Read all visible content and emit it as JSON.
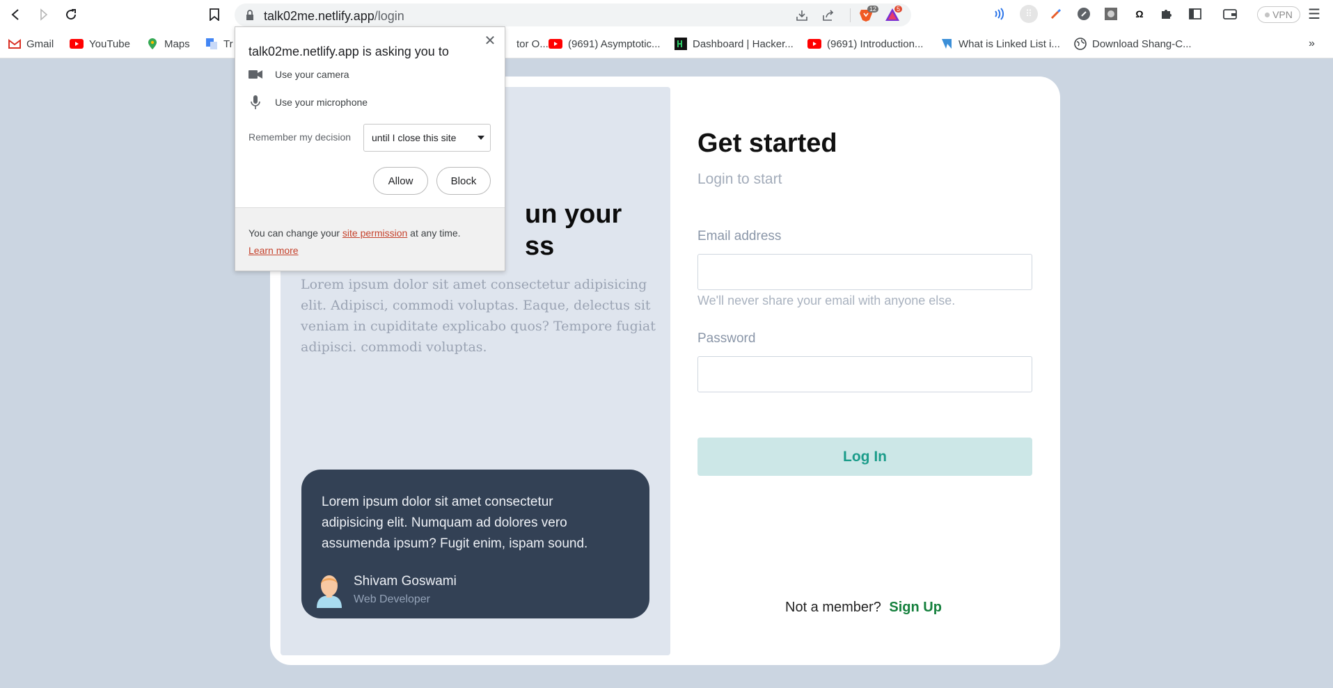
{
  "browser": {
    "url_host": "talk02me.netlify.app",
    "url_path": "/login",
    "brave_badge": "12",
    "rewards_badge": "5",
    "vpn_label": "VPN"
  },
  "bookmarks": [
    {
      "label": "Gmail"
    },
    {
      "label": "YouTube"
    },
    {
      "label": "Maps"
    },
    {
      "label": "Tr"
    },
    {
      "label": "tor O..."
    },
    {
      "label": "(9691) Asymptotic..."
    },
    {
      "label": "Dashboard | Hacker..."
    },
    {
      "label": "(9691) Introduction..."
    },
    {
      "label": "What is Linked List i..."
    },
    {
      "label": "Download Shang-C..."
    }
  ],
  "permission_popup": {
    "title": "talk02me.netlify.app is asking you to",
    "camera": "Use your camera",
    "microphone": "Use your microphone",
    "remember_label": "Remember my decision",
    "remember_value": "until I close this site",
    "allow": "Allow",
    "block": "Block",
    "footer_pre": "You can change your ",
    "footer_link": "site permission",
    "footer_post": " at any time.",
    "learn_more": "Learn more"
  },
  "left": {
    "hero_line1": "un your",
    "hero_line2": "ss",
    "hero_text": "Lorem ipsum dolor sit amet consectetur adipisicing elit. Adipisci, commodi voluptas. Eaque, delectus sit veniam in cupiditate explicabo quos? Tempore fugiat adipisci. commodi voluptas.",
    "testimonial": {
      "quote": "Lorem ipsum dolor sit amet consectetur adipisicing elit. Numquam ad dolores vero assumenda ipsum? Fugit enim, ispam sound.",
      "name": "Shivam Goswami",
      "role": "Web Developer"
    }
  },
  "form": {
    "title": "Get started",
    "subtitle": "Login to start",
    "email_label": "Email address",
    "email_value": "",
    "email_hint": "We'll never share your email with anyone else.",
    "password_label": "Password",
    "password_value": "",
    "login_button": "Log In",
    "not_member": "Not a member?",
    "sign_up": "Sign Up"
  }
}
